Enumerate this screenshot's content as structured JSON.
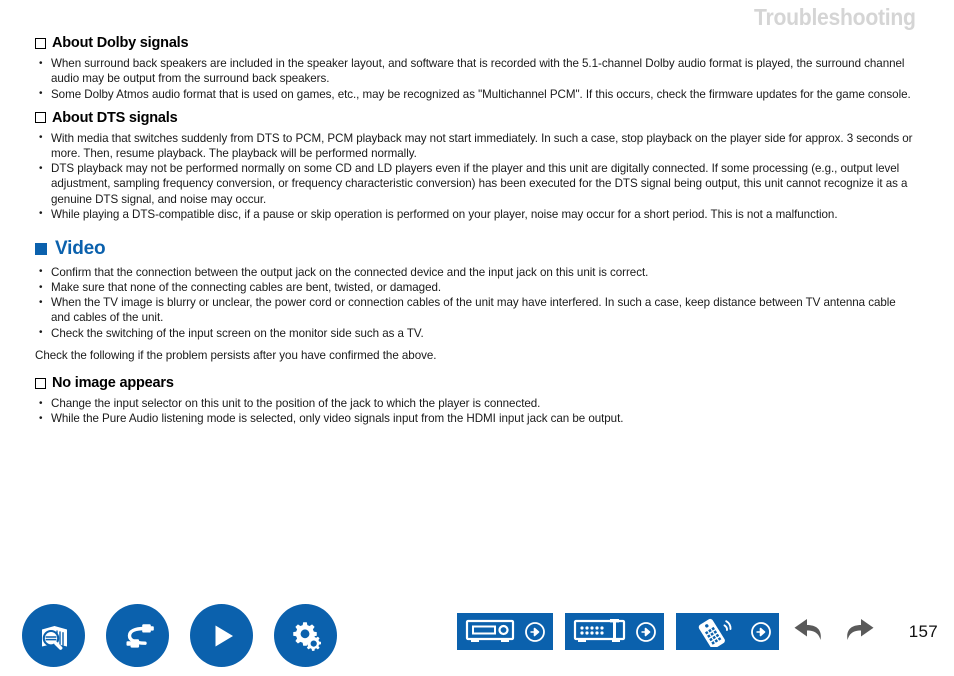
{
  "header": {
    "title": "Troubleshooting",
    "color": "#d5d5d5"
  },
  "theme": {
    "accent_blue": "#0b61ad",
    "text_black": "#1a1a1a"
  },
  "sections": [
    {
      "id": "about-dolby-signals",
      "type": "sub",
      "heading": "About Dolby signals",
      "bullets": [
        "When surround back speakers are included in the speaker layout, and software that is recorded with the 5.1-channel Dolby audio format is played, the surround channel audio may be output from the surround back speakers.",
        "Some Dolby Atmos audio format that is used on games, etc., may be recognized as \"Multichannel PCM\". If this occurs, check the firmware updates for the game console."
      ]
    },
    {
      "id": "about-dts-signals",
      "type": "sub",
      "heading": "About DTS signals",
      "bullets": [
        "With media that switches suddenly from DTS to PCM, PCM playback may not start immediately. In such a case, stop playback on the player side for approx. 3 seconds or more. Then, resume playback. The playback will be performed normally.",
        "DTS playback may not be performed normally on some CD and LD players even if the player and this unit are digitally connected. If some processing (e.g., output level adjustment, sampling frequency conversion, or frequency characteristic conversion) has been executed for the DTS signal being output, this unit cannot recognize it as a genuine DTS signal, and noise may occur.",
        "While playing a DTS-compatible disc, if a pause or skip operation is performed on your player, noise may occur for a short period. This is not a malfunction."
      ]
    },
    {
      "id": "video",
      "type": "main",
      "heading": "Video",
      "bullets": [
        "Confirm that the connection between the output jack on the connected device and the input jack on this unit is correct.",
        "Make sure that none of the connecting cables are bent, twisted, or damaged.",
        "When the TV image is blurry or unclear, the power cord or connection cables of the unit may have interfered. In such a case, keep distance between TV antenna cable and cables of the unit.",
        "Check the switching of the input screen on the monitor side such as a TV."
      ],
      "footnote": "Check the following if the problem persists after you have confirmed the above."
    },
    {
      "id": "no-image-appears",
      "type": "sub",
      "heading": "No image appears",
      "bullets": [
        "Change the input selector on this unit to the position of the jack to which the player is connected.",
        "While the Pure Audio listening mode is selected, only video signals input from the HDMI input jack can be output."
      ]
    }
  ],
  "footer": {
    "round_buttons": [
      {
        "name": "book-search-icon",
        "label": "Index / Search"
      },
      {
        "name": "cable-connections-icon",
        "label": "Connections"
      },
      {
        "name": "play-icon",
        "label": "Playback"
      },
      {
        "name": "gears-setup-icon",
        "label": "Setup"
      }
    ],
    "rect_buttons": [
      {
        "name": "front-panel-icon",
        "label": "Front panel"
      },
      {
        "name": "rear-panel-icon",
        "label": "Rear panel"
      },
      {
        "name": "remote-controller-icon",
        "label": "Remote controller"
      }
    ],
    "history_buttons": [
      {
        "name": "back-arrow-icon",
        "label": "Back"
      },
      {
        "name": "forward-arrow-icon",
        "label": "Forward"
      }
    ],
    "page_number": "157"
  }
}
